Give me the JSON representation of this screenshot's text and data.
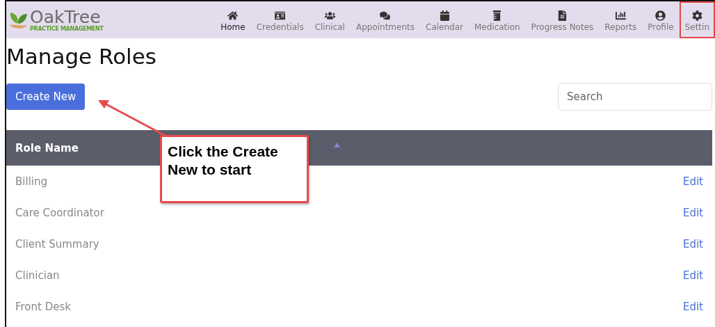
{
  "header": {
    "logo": {
      "name": "OakTree",
      "tagline": "PRACTICE MANAGEMENT"
    },
    "nav": [
      {
        "label": "Home",
        "selected": true,
        "highlighted": false
      },
      {
        "label": "Credentials",
        "selected": false,
        "highlighted": false
      },
      {
        "label": "Clinical",
        "selected": false,
        "highlighted": false
      },
      {
        "label": "Appointments",
        "selected": false,
        "highlighted": false
      },
      {
        "label": "Calendar",
        "selected": false,
        "highlighted": false
      },
      {
        "label": "Medication",
        "selected": false,
        "highlighted": false
      },
      {
        "label": "Progress Notes",
        "selected": false,
        "highlighted": false
      },
      {
        "label": "Reports",
        "selected": false,
        "highlighted": false
      },
      {
        "label": "Profile",
        "selected": false,
        "highlighted": false
      },
      {
        "label": "Settin",
        "selected": false,
        "highlighted": true
      }
    ]
  },
  "page_title": "Manage Roles",
  "create_button": "Create New",
  "search": {
    "placeholder": "Search"
  },
  "table": {
    "columns": [
      "Role Name"
    ],
    "rows": [
      {
        "name": "Billing",
        "action": "Edit"
      },
      {
        "name": "Care Coordinator",
        "action": "Edit"
      },
      {
        "name": "Client Summary",
        "action": "Edit"
      },
      {
        "name": "Clinician",
        "action": "Edit"
      },
      {
        "name": "Front Desk",
        "action": "Edit"
      }
    ]
  },
  "callout": {
    "text": "Click the Create New to start"
  }
}
